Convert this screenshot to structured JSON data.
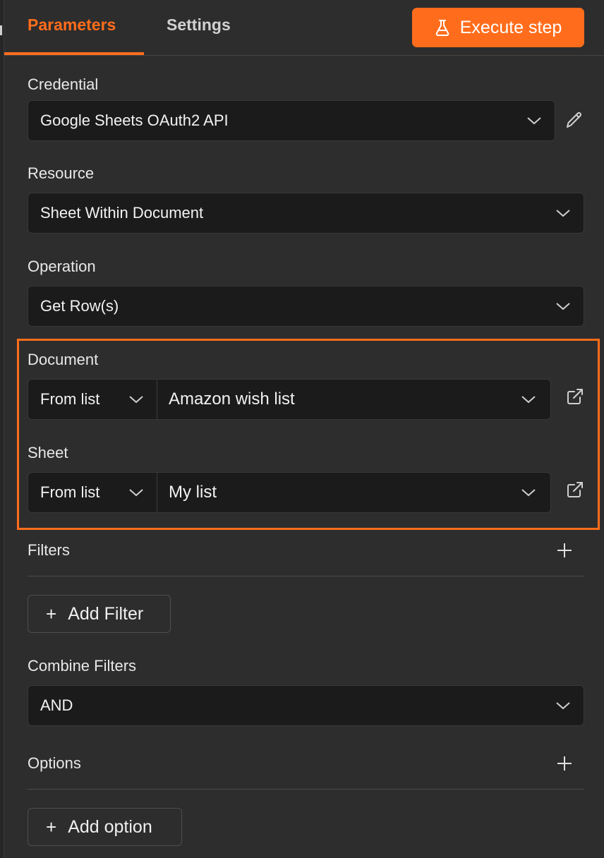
{
  "tabs": {
    "parameters": "Parameters",
    "settings": "Settings"
  },
  "execute_button": "Execute step",
  "credential": {
    "label": "Credential",
    "value": "Google Sheets OAuth2 API"
  },
  "resource": {
    "label": "Resource",
    "value": "Sheet Within Document"
  },
  "operation": {
    "label": "Operation",
    "value": "Get Row(s)"
  },
  "document": {
    "label": "Document",
    "mode": "From list",
    "value": "Amazon wish list"
  },
  "sheet": {
    "label": "Sheet",
    "mode": "From list",
    "value": "My list"
  },
  "filters": {
    "label": "Filters",
    "add_button": "Add Filter",
    "add_glyph": "+"
  },
  "combine_filters": {
    "label": "Combine Filters",
    "value": "AND"
  },
  "options": {
    "label": "Options",
    "add_button": "Add option",
    "add_glyph": "+"
  },
  "colors": {
    "accent": "#ff6d1c",
    "background": "#2d2d2d",
    "field": "#1b1b1b"
  }
}
